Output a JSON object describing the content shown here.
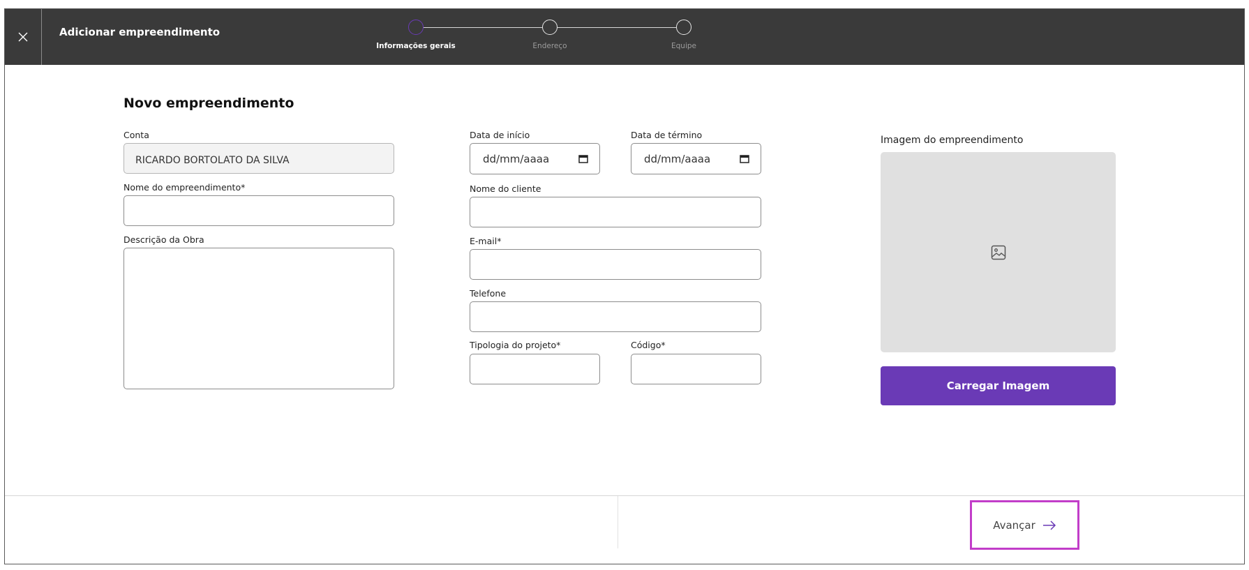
{
  "header": {
    "title": "Adicionar empreendimento",
    "steps": [
      {
        "label": "Informações gerais",
        "active": true
      },
      {
        "label": "Endereço",
        "active": false
      },
      {
        "label": "Equipe",
        "active": false
      }
    ]
  },
  "form": {
    "section_title": "Novo empreendimento",
    "conta": {
      "label": "Conta",
      "value": "RICARDO BORTOLATO DA SILVA"
    },
    "nome_empreendimento": {
      "label": "Nome do empreendimento*",
      "value": ""
    },
    "descricao": {
      "label": "Descrição da Obra",
      "value": ""
    },
    "data_inicio": {
      "label": "Data de início",
      "placeholder": "dd/mm/aaaa"
    },
    "data_termino": {
      "label": "Data de término",
      "placeholder": "dd/mm/aaaa"
    },
    "nome_cliente": {
      "label": "Nome do cliente",
      "value": ""
    },
    "email": {
      "label": "E-mail*",
      "value": ""
    },
    "telefone": {
      "label": "Telefone",
      "value": ""
    },
    "tipologia": {
      "label": "Tipologia do projeto*",
      "value": ""
    },
    "codigo": {
      "label": "Código*",
      "value": ""
    }
  },
  "image": {
    "label": "Imagem do empreendimento",
    "upload_label": "Carregar Imagem"
  },
  "footer": {
    "next_label": "Avançar"
  },
  "colors": {
    "header_bg": "#3a3a3a",
    "accent": "#6a3ab6",
    "highlight": "#c23dc9"
  }
}
